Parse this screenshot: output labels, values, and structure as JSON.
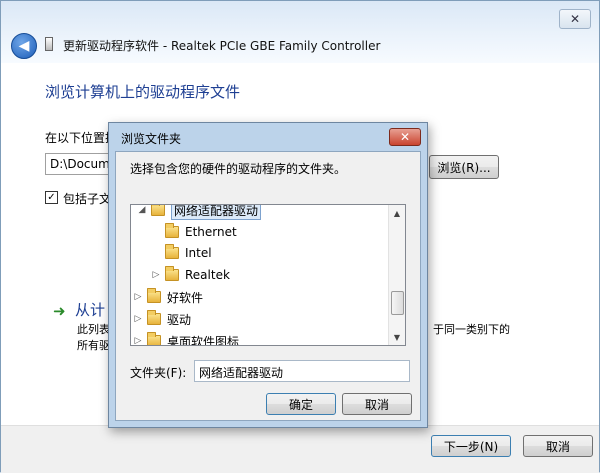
{
  "wizard": {
    "title": "更新驱动程序软件 - Realtek PCIe GBE Family Controller",
    "heading": "浏览计算机上的驱动程序文件",
    "search_label": "在以下位置搜",
    "path_value": "D:\\Docume",
    "browse_label": "浏览(R)...",
    "include_subfolders_label": "包括子文",
    "include_subfolders_checked": true,
    "pick_link": "从计",
    "pick_desc_line1": "此列表",
    "pick_desc_line2": "所有驱",
    "pick_desc_right": "于同一类别下的",
    "next_label": "下一步(N)",
    "cancel_label": "取消",
    "close_symbol": "✕",
    "back_symbol": "◀"
  },
  "dialog": {
    "title": "浏览文件夹",
    "close_symbol": "✕",
    "description": "选择包含您的硬件的驱动程序的文件夹。",
    "tree": [
      {
        "label": "网络适配器驱动",
        "expander": "◢",
        "selected": true
      },
      {
        "label": "Ethernet",
        "expander": "",
        "selected": false
      },
      {
        "label": "Intel",
        "expander": "",
        "selected": false
      },
      {
        "label": "Realtek",
        "expander": "▷",
        "selected": false
      },
      {
        "label": "好软件",
        "expander": "▷",
        "selected": false
      },
      {
        "label": "驱动",
        "expander": "▷",
        "selected": false
      },
      {
        "label": "桌面软件图标",
        "expander": "▷",
        "selected": false
      }
    ],
    "folder_label": "文件夹(F):",
    "folder_value": "网络适配器驱动",
    "ok_label": "确定",
    "cancel_label": "取消"
  }
}
